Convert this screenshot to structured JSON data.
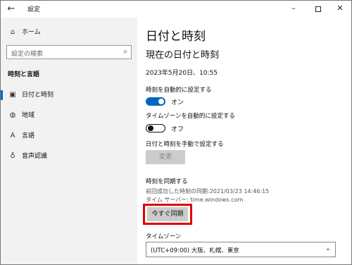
{
  "window": {
    "title": "設定",
    "controls": {
      "minimize": "–",
      "maximize": "☐",
      "close": "✕"
    }
  },
  "sidebar": {
    "home_label": "ホーム",
    "search_placeholder": "設定の検索",
    "section_heading": "時刻と言語",
    "items": [
      {
        "label": "日付と時刻",
        "icon": "calendar-icon",
        "active": true
      },
      {
        "label": "地域",
        "icon": "globe-icon",
        "active": false
      },
      {
        "label": "言語",
        "icon": "language-icon",
        "active": false
      },
      {
        "label": "音声認識",
        "icon": "microphone-icon",
        "active": false
      }
    ]
  },
  "main": {
    "page_title": "日付と時刻",
    "sub_title": "現在の日付と時刻",
    "current_datetime": "2023年5月20日、10:55",
    "auto_time_label": "時刻を自動的に設定する",
    "auto_time_state": "オン",
    "auto_tz_label": "タイムゾーンを自動的に設定する",
    "auto_tz_state": "オフ",
    "manual_label": "日付と時刻を手動で設定する",
    "change_button": "変更",
    "sync_heading": "時刻を同期する",
    "last_sync": "前回成功した時刻の同期:2021/03/23 14:46:15",
    "time_server": "タイム サーバー: time.windows.com",
    "sync_now_button": "今すぐ同期",
    "timezone_label": "タイムゾーン",
    "timezone_value": "(UTC+09:00) 大阪、札幌、東京"
  },
  "colors": {
    "accent": "#0067c0",
    "sidebar_bg": "#f2f2f2",
    "highlight": "#e00000"
  }
}
